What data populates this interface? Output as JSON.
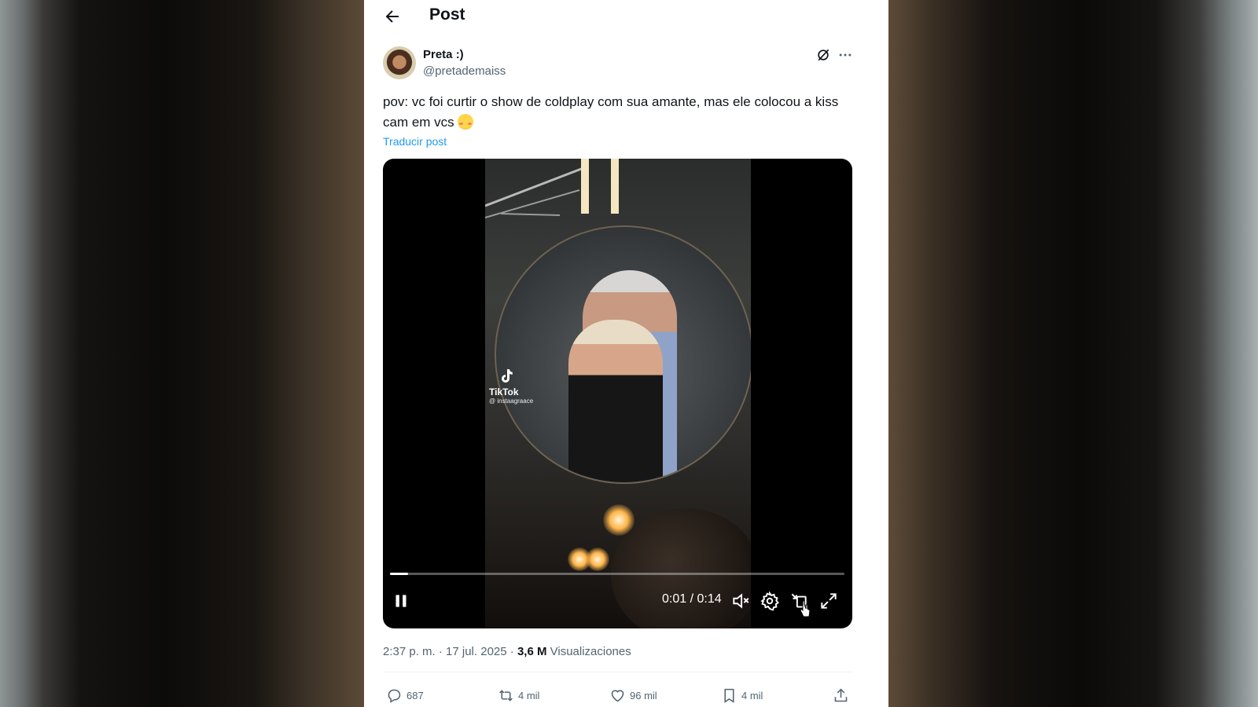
{
  "header": {
    "title": "Post",
    "back_icon": "arrow-left-icon"
  },
  "post": {
    "author": {
      "name": "Preta :)",
      "handle": "@pretademaiss"
    },
    "text": "pov: vc foi curtir o show de coldplay com sua amante, mas ele colocou a kiss cam em vcs",
    "translate_label": "Traducir post",
    "timestamp": "2:37 p. m. · 17 jul. 2025 ·",
    "views_count": "3,6 M",
    "views_label": "Visualizaciones"
  },
  "video": {
    "watermark_brand": "TikTok",
    "watermark_user": "@ instaagraace",
    "current_time": "0:01",
    "duration": "0:14",
    "time_display": "0:01 / 0:14",
    "progress_fraction": 0.04
  },
  "actions": {
    "replies": "687",
    "reposts": "4 mil",
    "likes": "96 mil",
    "bookmarks": "4 mil"
  },
  "colors": {
    "link": "#1d9bf0",
    "text": "#0f1419",
    "secondary": "#536471"
  }
}
